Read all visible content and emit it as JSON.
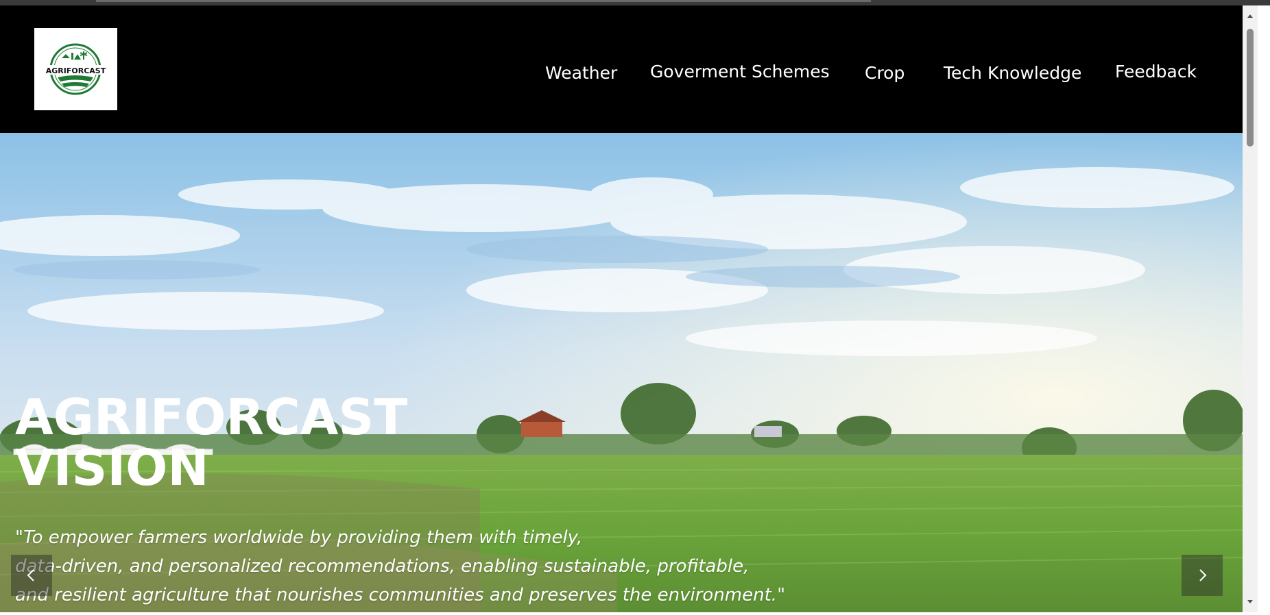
{
  "logo": {
    "text": "AGRIFORCAST"
  },
  "nav": {
    "items": [
      {
        "label": "Weather",
        "name": "nav-weather"
      },
      {
        "label": "Goverment Schemes",
        "name": "nav-government-schemes"
      },
      {
        "label": "Crop",
        "name": "nav-crop"
      },
      {
        "label": "Tech Knowledge",
        "name": "nav-tech-knowledge"
      },
      {
        "label": "Feedback",
        "name": "nav-feedback"
      }
    ]
  },
  "hero": {
    "title_line1": "AGRIFORCAST",
    "title_line2": "VISION",
    "quote_lines": [
      "\"To empower farmers worldwide by providing them with timely,",
      "data-driven, and personalized recommendations, enabling sustainable, profitable,",
      "and resilient agriculture that nourishes communities and preserves the environment.\""
    ],
    "prev_icon": "chevron-left-icon",
    "next_icon": "chevron-right-icon"
  },
  "colors": {
    "header_bg": "#000000",
    "nav_text": "#ffffff",
    "logo_green": "#1f7a33"
  }
}
